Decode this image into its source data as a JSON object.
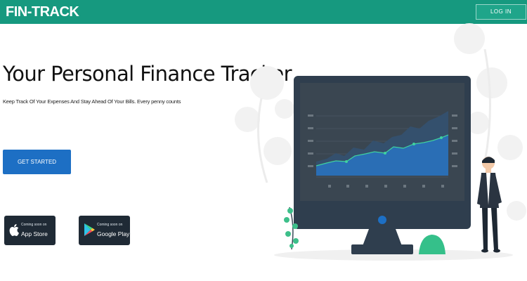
{
  "header": {
    "brand": "FIN-TRACK",
    "login_label": "LOG IN",
    "brand_color": "#16997f"
  },
  "hero": {
    "title": "Your Personal Finance Tracker",
    "subtitle": "Keep Track Of Your Expenses And Stay Ahead Of Your Bills. Every penny counts",
    "cta_label": "GET STARTED",
    "cta_color": "#1d6fc4"
  },
  "stores": [
    {
      "icon": "apple-icon",
      "small": "Coming soon on",
      "name": "App Store"
    },
    {
      "icon": "google-play-icon",
      "small": "Coming soon on",
      "name": "Google Play"
    }
  ]
}
